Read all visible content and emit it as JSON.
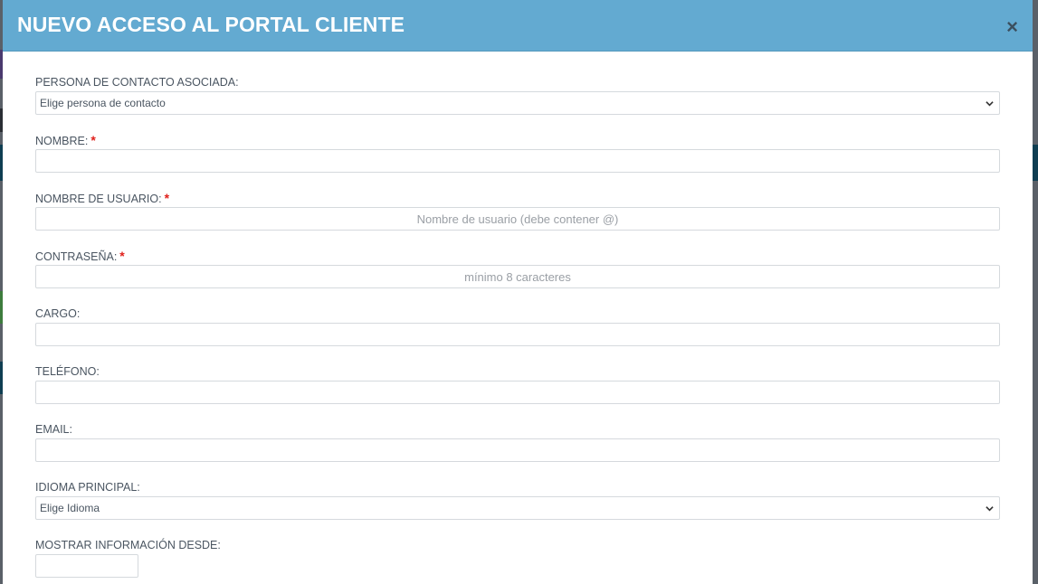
{
  "modal": {
    "title": "NUEVO ACCESO AL PORTAL CLIENTE",
    "close_symbol": "×"
  },
  "form": {
    "contact_person": {
      "label": "PERSONA DE CONTACTO ASOCIADA:",
      "selected": "Elige persona de contacto"
    },
    "name": {
      "label": "NOMBRE:",
      "required_mark": "*",
      "value": ""
    },
    "username": {
      "label": "NOMBRE DE USUARIO:",
      "required_mark": "*",
      "placeholder": "Nombre de usuario (debe contener @)"
    },
    "password": {
      "label": "CONTRASEÑA:",
      "required_mark": "*",
      "placeholder": "mínimo 8 caracteres"
    },
    "position": {
      "label": "CARGO:",
      "value": ""
    },
    "phone": {
      "label": "TELÉFONO:",
      "value": ""
    },
    "email": {
      "label": "EMAIL:",
      "value": ""
    },
    "language": {
      "label": "IDIOMA PRINCIPAL:",
      "selected": "Elige Idioma"
    },
    "show_info_from": {
      "label": "MOSTRAR INFORMACIÓN DESDE:",
      "value": ""
    }
  },
  "icons": {
    "close": "close-icon",
    "select_arrow": "chevron-down-icon"
  },
  "colors": {
    "header_bg": "#63aad1",
    "required": "#e0201b"
  }
}
